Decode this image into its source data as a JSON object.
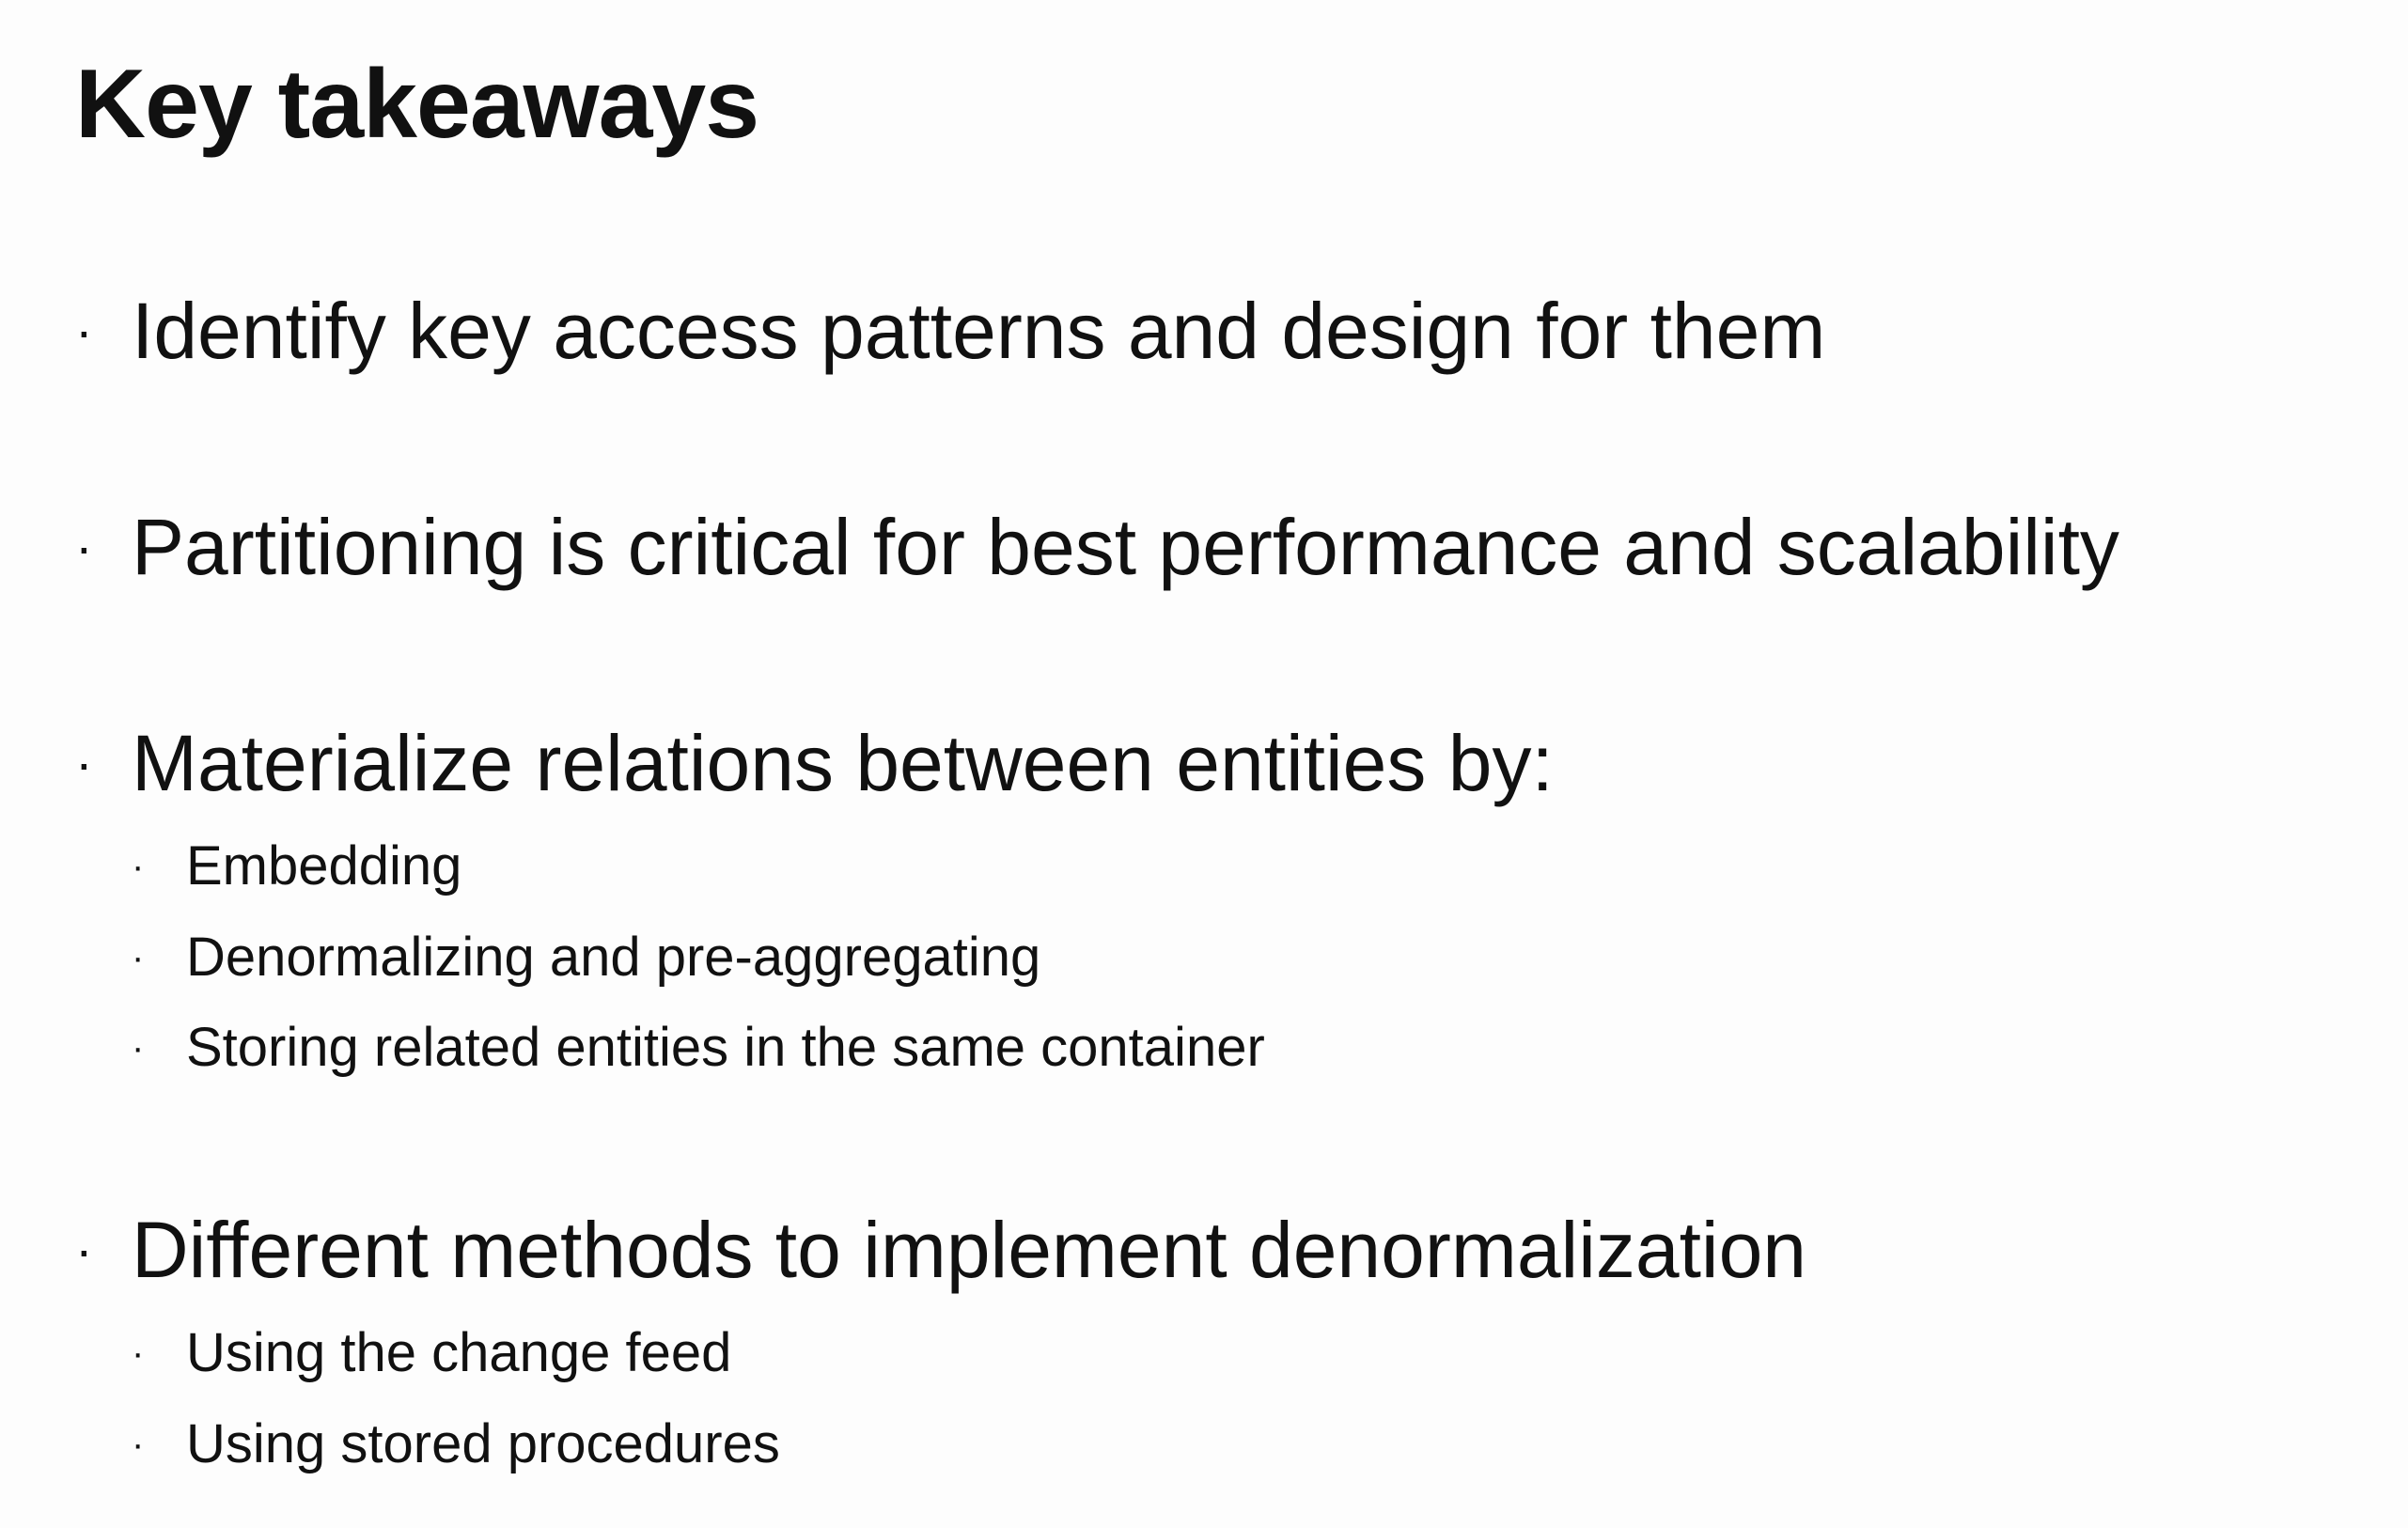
{
  "slide": {
    "title": "Key takeaways",
    "bullet_glyph": "·",
    "items": [
      {
        "text": "Identify key access patterns and design for them",
        "subitems": []
      },
      {
        "text": "Partitioning is critical for best performance and scalability",
        "subitems": []
      },
      {
        "text": "Materialize relations between entities by:",
        "subitems": [
          "Embedding",
          "Denormalizing and pre-aggregating",
          "Storing related entities in the same container"
        ]
      },
      {
        "text": "Different methods to implement denormalization",
        "subitems": [
          "Using the change feed",
          "Using stored procedures"
        ]
      }
    ]
  }
}
